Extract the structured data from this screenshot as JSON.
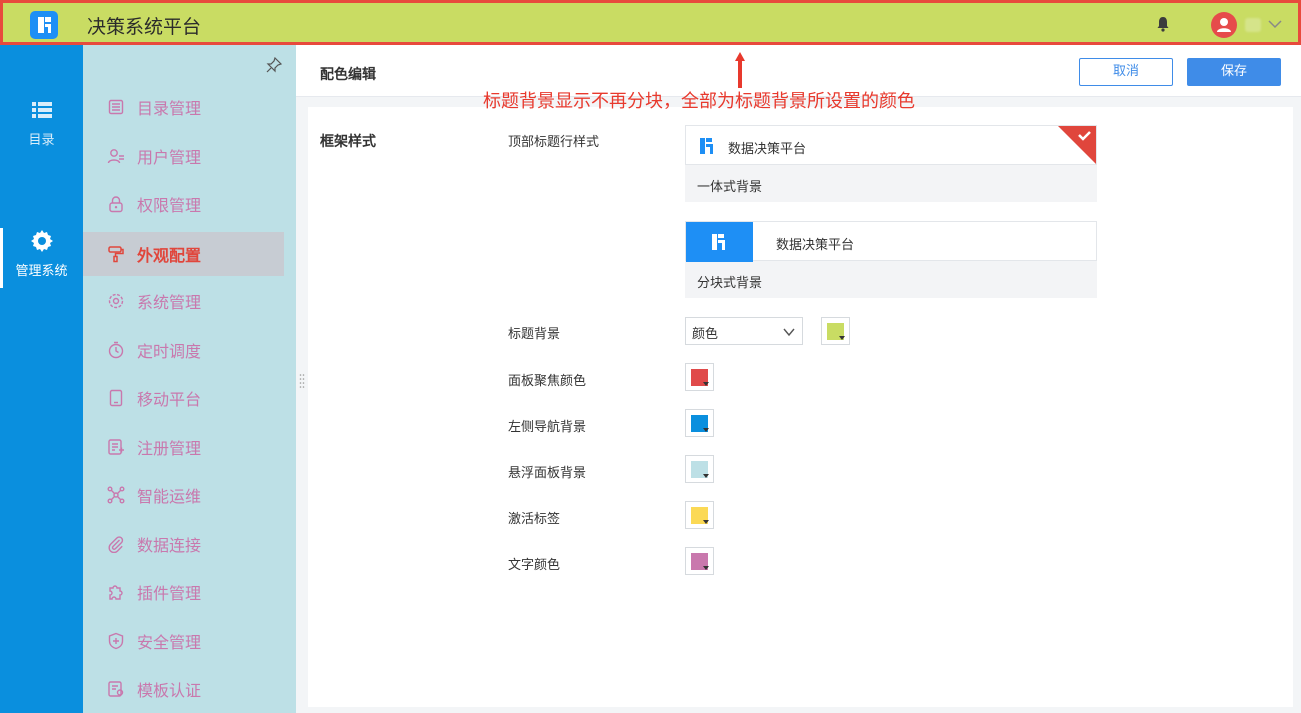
{
  "header": {
    "app_title": "决策系统平台",
    "bell_icon": "bell-icon",
    "avatar_icon": "user-avatar-icon"
  },
  "left_nav": {
    "items": [
      {
        "label": "目录",
        "icon": "list-icon"
      },
      {
        "label": "管理系统",
        "icon": "gear-icon"
      }
    ]
  },
  "sub_nav": {
    "items": [
      {
        "label": "目录管理",
        "icon": "catalog-icon"
      },
      {
        "label": "用户管理",
        "icon": "user-manage-icon"
      },
      {
        "label": "权限管理",
        "icon": "lock-icon"
      },
      {
        "label": "外观配置",
        "icon": "paint-roller-icon"
      },
      {
        "label": "系统管理",
        "icon": "settings-icon"
      },
      {
        "label": "定时调度",
        "icon": "timer-icon"
      },
      {
        "label": "移动平台",
        "icon": "mobile-icon"
      },
      {
        "label": "注册管理",
        "icon": "register-icon"
      },
      {
        "label": "智能运维",
        "icon": "network-icon"
      },
      {
        "label": "数据连接",
        "icon": "paperclip-icon"
      },
      {
        "label": "插件管理",
        "icon": "puzzle-icon"
      },
      {
        "label": "安全管理",
        "icon": "shield-icon"
      },
      {
        "label": "模板认证",
        "icon": "certificate-icon"
      }
    ],
    "active": "外观配置"
  },
  "main": {
    "title": "配色编辑",
    "cancel_label": "取消",
    "save_label": "保存",
    "annotation": "标题背景显示不再分块，全部为标题背景所设置的颜色",
    "section_label": "框架样式",
    "header_style_label": "顶部标题行样式",
    "card_unified": {
      "name": "数据决策平台",
      "caption": "一体式背景"
    },
    "card_split": {
      "name": "数据决策平台",
      "caption": "分块式背景"
    },
    "title_bg_label": "标题背景",
    "title_bg_select": "颜色",
    "colors": [
      {
        "label": "标题背景",
        "value": "#c9dc63"
      },
      {
        "label": "面板聚焦颜色",
        "value": "#e04a4a"
      },
      {
        "label": "左侧导航背景",
        "value": "#0a8fde"
      },
      {
        "label": "悬浮面板背景",
        "value": "#bde0e6"
      },
      {
        "label": "激活标签",
        "value": "#fbd955"
      },
      {
        "label": "文字颜色",
        "value": "#c978ad"
      }
    ]
  }
}
